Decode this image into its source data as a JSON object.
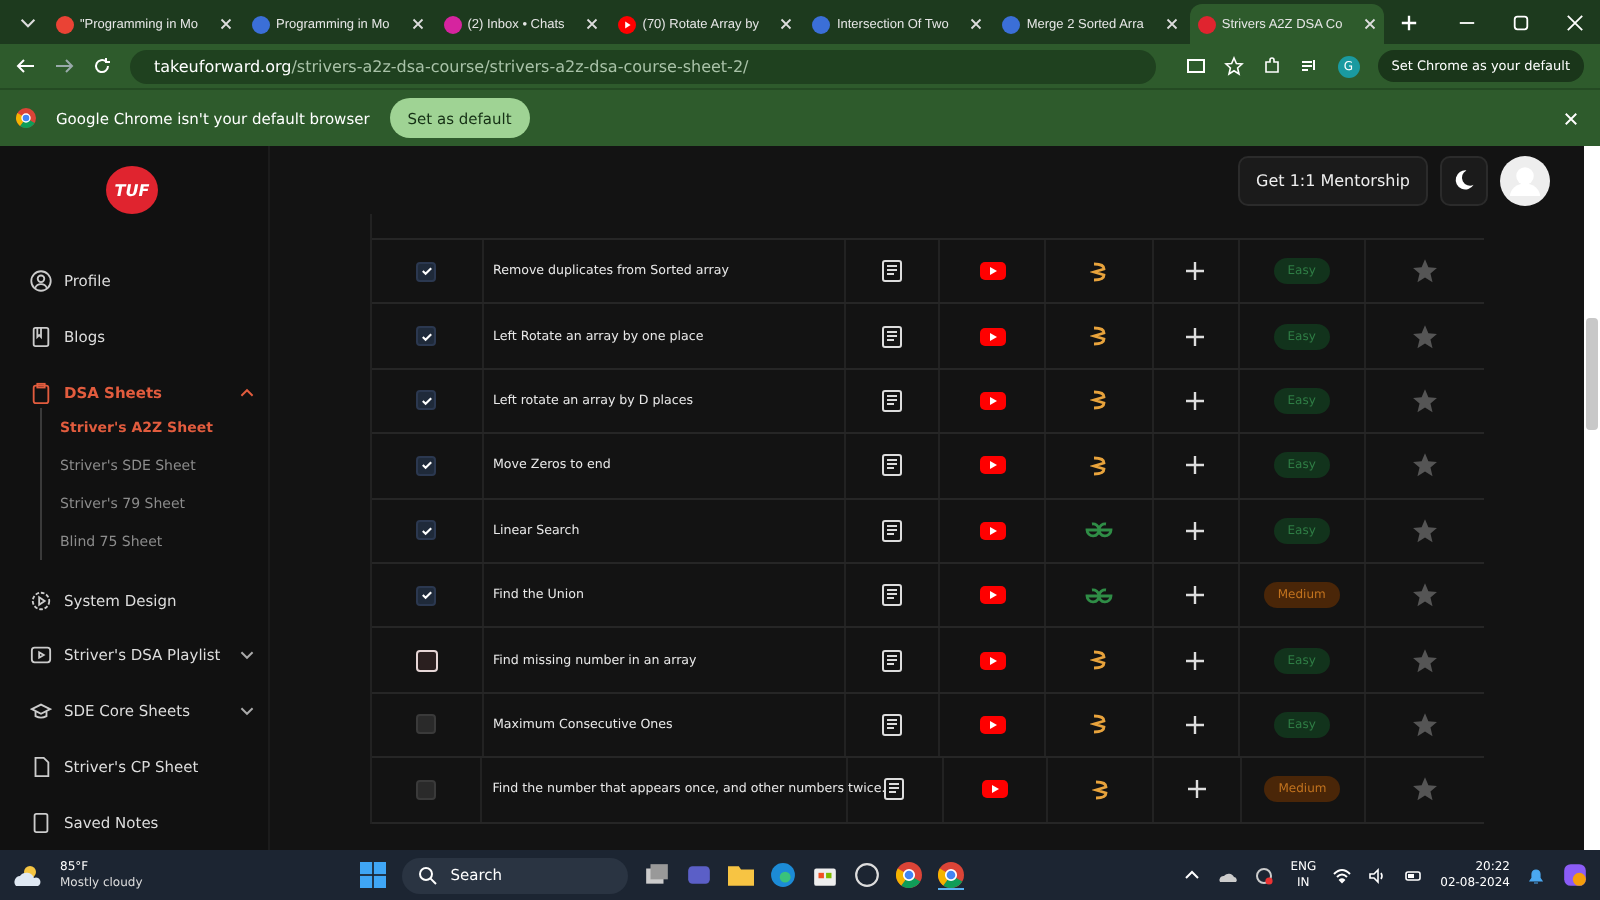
{
  "tabs": [
    {
      "title": "\"Programming in Mo",
      "kind": "mail",
      "selected": false
    },
    {
      "title": "Programming in Mo",
      "kind": "site",
      "selected": false
    },
    {
      "title": "(2) Inbox • Chats",
      "kind": "camera",
      "selected": false
    },
    {
      "title": "(70) Rotate Array by",
      "kind": "video",
      "selected": false
    },
    {
      "title": "Intersection Of Two",
      "kind": "site",
      "selected": false
    },
    {
      "title": "Merge 2 Sorted Arra",
      "kind": "site",
      "selected": false
    },
    {
      "title": "Strivers A2Z DSA Co",
      "kind": "logo",
      "selected": true
    }
  ],
  "address": {
    "domain": "takeuforward.org",
    "path": "/strivers-a2z-dsa-course/strivers-a2z-dsa-course-sheet-2/"
  },
  "profile_initial": "G",
  "default_button": "Set Chrome as your default",
  "infobar": {
    "message": "Google Chrome isn't your default browser",
    "button": "Set as default"
  },
  "logo": "TUF",
  "sidebar": [
    {
      "label": "Profile",
      "kind": "profile",
      "selected": false
    },
    {
      "label": "Blogs",
      "kind": "book",
      "selected": false
    },
    {
      "label": "DSA Sheets",
      "kind": "clipboard",
      "expanded": true,
      "selected": true,
      "children": [
        {
          "label": "Striver's A2Z Sheet",
          "selected": true
        },
        {
          "label": "Striver's SDE Sheet",
          "selected": false
        },
        {
          "label": "Striver's 79 Sheet",
          "selected": false
        },
        {
          "label": "Blind 75 Sheet",
          "selected": false
        }
      ]
    },
    {
      "label": "System Design",
      "kind": "gear",
      "selected": false
    },
    {
      "label": "Striver's DSA Playlist",
      "kind": "play",
      "expanded": false,
      "selected": false
    },
    {
      "label": "SDE Core Sheets",
      "kind": "cap",
      "expanded": false,
      "selected": false
    },
    {
      "label": "Striver's CP Sheet",
      "kind": "file",
      "selected": false
    },
    {
      "label": "Saved Notes",
      "kind": "note",
      "selected": false
    }
  ],
  "header": {
    "mentorship": "Get 1:1 Mentorship"
  },
  "rows": [
    {
      "checked": true,
      "focused": false,
      "problem": "Remove duplicates from Sorted array",
      "practice": {
        "kind": "cn"
      },
      "difficulty": {
        "label": "Easy",
        "kind": "easy"
      },
      "starred": false
    },
    {
      "checked": true,
      "focused": false,
      "problem": "Left Rotate an array by one place",
      "practice": {
        "kind": "cn"
      },
      "difficulty": {
        "label": "Easy",
        "kind": "easy"
      },
      "starred": false
    },
    {
      "checked": true,
      "focused": false,
      "problem": "Left rotate an array by D places",
      "practice": {
        "kind": "cn"
      },
      "difficulty": {
        "label": "Easy",
        "kind": "easy"
      },
      "starred": false
    },
    {
      "checked": true,
      "focused": false,
      "problem": "Move Zeros to end",
      "practice": {
        "kind": "cn"
      },
      "difficulty": {
        "label": "Easy",
        "kind": "easy"
      },
      "starred": false
    },
    {
      "checked": true,
      "focused": false,
      "problem": "Linear Search",
      "practice": {
        "kind": "gfg"
      },
      "difficulty": {
        "label": "Easy",
        "kind": "easy"
      },
      "starred": false
    },
    {
      "checked": true,
      "focused": false,
      "problem": "Find the Union",
      "practice": {
        "kind": "gfg"
      },
      "difficulty": {
        "label": "Medium",
        "kind": "medium"
      },
      "starred": false
    },
    {
      "checked": false,
      "focused": true,
      "problem": "Find missing number in an array",
      "practice": {
        "kind": "cn"
      },
      "difficulty": {
        "label": "Easy",
        "kind": "easy"
      },
      "starred": false
    },
    {
      "checked": false,
      "focused": false,
      "problem": "Maximum Consecutive Ones",
      "practice": {
        "kind": "cn"
      },
      "difficulty": {
        "label": "Easy",
        "kind": "easy"
      },
      "starred": false
    },
    {
      "checked": false,
      "focused": false,
      "problem": "Find the number that appears once, and other numbers twice.",
      "practice": {
        "kind": "cn"
      },
      "difficulty": {
        "label": "Medium",
        "kind": "medium"
      },
      "starred": false
    }
  ],
  "taskbar": {
    "temperature": "85°F",
    "weather": "Mostly cloudy",
    "search": "Search",
    "language": "ENG",
    "region": "IN",
    "time": "20:22",
    "date": "02-08-2024"
  }
}
